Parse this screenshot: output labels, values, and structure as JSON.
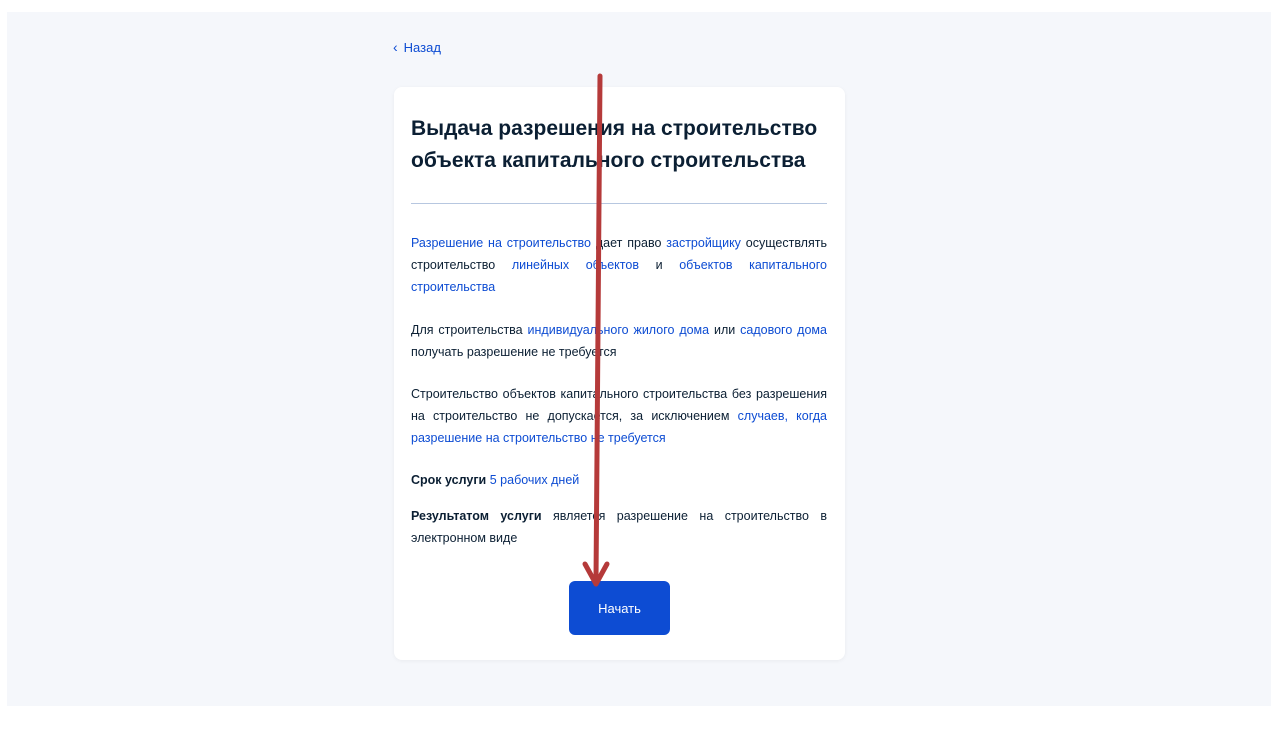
{
  "nav": {
    "back_label": "Назад"
  },
  "card": {
    "title": "Выдача разрешения на строительство объекта капитального строительства",
    "p1": {
      "link1": "Разрешение на строительство",
      "t1": " дает право ",
      "link2": "застройщику",
      "t2": " осуществлять строительство ",
      "link3": "линейных объектов",
      "t3": " и ",
      "link4": "объектов капитального строительства"
    },
    "p2": {
      "t1": "Для строительства ",
      "link1": "индивидуального жилого дома",
      "t2": " или ",
      "link2": "садового дома",
      "t3": " получать разрешение не требуется"
    },
    "p3": {
      "t1": "Строительство объектов капитального строительства без разрешения на строительство не допускается, за исключением ",
      "link1": "случаев, когда разрешение на строительство не требуется"
    },
    "p4": {
      "bold": "Срок услуги",
      "link1": "5 рабочих дней"
    },
    "p5": {
      "bold": "Результатом услуги",
      "t1": " является разрешение на строительство в электронном виде"
    },
    "start_label": "Начать"
  },
  "colors": {
    "accent": "#0d4cd3",
    "text": "#0b1f33",
    "background": "#f5f7fb",
    "annotation_arrow": "#b53a3a"
  },
  "icons": {
    "back": "chevron-left-icon"
  }
}
